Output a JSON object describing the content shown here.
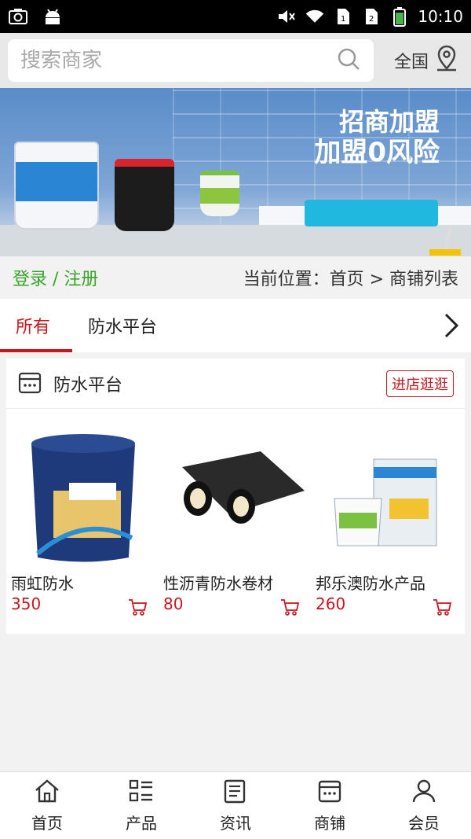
{
  "status_bar": {
    "time": "10:10",
    "icons_left": [
      "screenshot-icon",
      "android-icon"
    ],
    "icons_right": [
      "mute-icon",
      "wifi-icon",
      "sim1-icon",
      "sim2-icon",
      "battery-icon"
    ]
  },
  "search": {
    "placeholder": "搜索商家",
    "region_label": "全国"
  },
  "banner": {
    "line1": "招商加盟",
    "line2": "加盟0风险"
  },
  "breadcrumb": {
    "login_label": "登录 / 注册",
    "path": "当前位置：首页 > 商铺列表"
  },
  "tabs": [
    {
      "label": "所有",
      "active": true
    },
    {
      "label": "防水平台",
      "active": false
    }
  ],
  "shop": {
    "name": "防水平台",
    "visit_label": "进店逛逛",
    "products": [
      {
        "name": "雨虹防水",
        "price": "350"
      },
      {
        "name": "性沥青防水卷材",
        "price": "80"
      },
      {
        "name": "邦乐澳防水产品",
        "price": "260"
      }
    ]
  },
  "bottom_nav": [
    {
      "label": "首页",
      "icon": "home-icon"
    },
    {
      "label": "产品",
      "icon": "list-icon"
    },
    {
      "label": "资讯",
      "icon": "news-icon"
    },
    {
      "label": "商铺",
      "icon": "shop-icon"
    },
    {
      "label": "会员",
      "icon": "user-icon"
    }
  ],
  "colors": {
    "accent_red": "#c8161d",
    "login_green": "#3aa32a"
  }
}
